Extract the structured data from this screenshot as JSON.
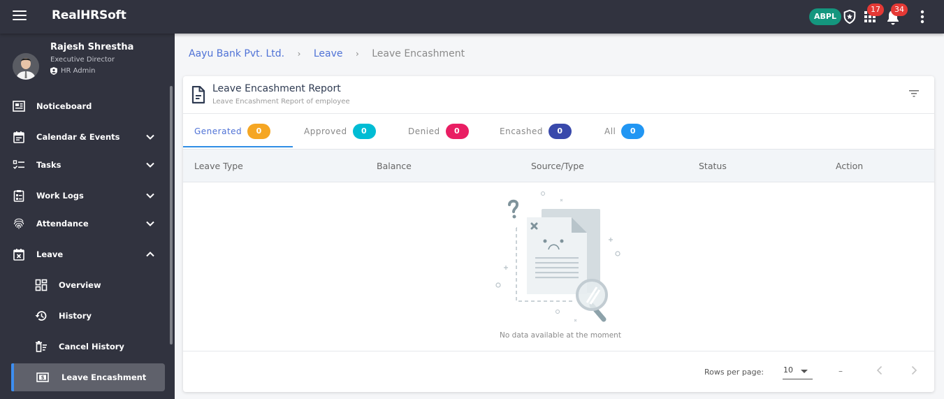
{
  "topbar": {
    "app_title": "RealHRSoft",
    "org_badge": "ABPL",
    "apps_count": "17",
    "notifications_count": "34"
  },
  "user": {
    "name": "Rajesh Shrestha",
    "title": "Executive Director",
    "role": "HR Admin"
  },
  "sidebar": {
    "items": [
      {
        "label": "Noticeboard",
        "icon": "newspaper-icon"
      },
      {
        "label": "Calendar & Events",
        "icon": "calendar-icon",
        "expandable": true
      },
      {
        "label": "Tasks",
        "icon": "checklist-icon",
        "expandable": true
      },
      {
        "label": "Work Logs",
        "icon": "clipboard-icon",
        "expandable": true
      },
      {
        "label": "Attendance",
        "icon": "fingerprint-icon",
        "expandable": true
      },
      {
        "label": "Leave",
        "icon": "calendar-x-icon",
        "expanded": true
      }
    ],
    "leave_subitems": [
      {
        "label": "Overview",
        "icon": "dashboard-icon"
      },
      {
        "label": "History",
        "icon": "history-icon"
      },
      {
        "label": "Cancel History",
        "icon": "delete-list-icon"
      },
      {
        "label": "Leave Encashment",
        "icon": "money-icon",
        "active": true
      }
    ]
  },
  "breadcrumb": {
    "items": [
      "Aayu Bank Pvt. Ltd.",
      "Leave",
      "Leave Encashment"
    ],
    "separator": "›"
  },
  "card": {
    "title": "Leave Encashment Report",
    "subtitle": "Leave Encashment Report of employee"
  },
  "tabs": [
    {
      "label": "Generated",
      "count": "0",
      "color": "#f5a623",
      "active": true
    },
    {
      "label": "Approved",
      "count": "0",
      "color": "#00bcd4"
    },
    {
      "label": "Denied",
      "count": "0",
      "color": "#e91e63"
    },
    {
      "label": "Encashed",
      "count": "0",
      "color": "#3949ab"
    },
    {
      "label": "All",
      "count": "0",
      "color": "#2196f3"
    }
  ],
  "table": {
    "columns": [
      "Leave Type",
      "Balance",
      "Source/Type",
      "Status",
      "Action"
    ],
    "rows": [],
    "empty_message": "No data available at the moment"
  },
  "pagination": {
    "rows_per_page_label": "Rows per page:",
    "rows_per_page": "10",
    "range": "–"
  }
}
